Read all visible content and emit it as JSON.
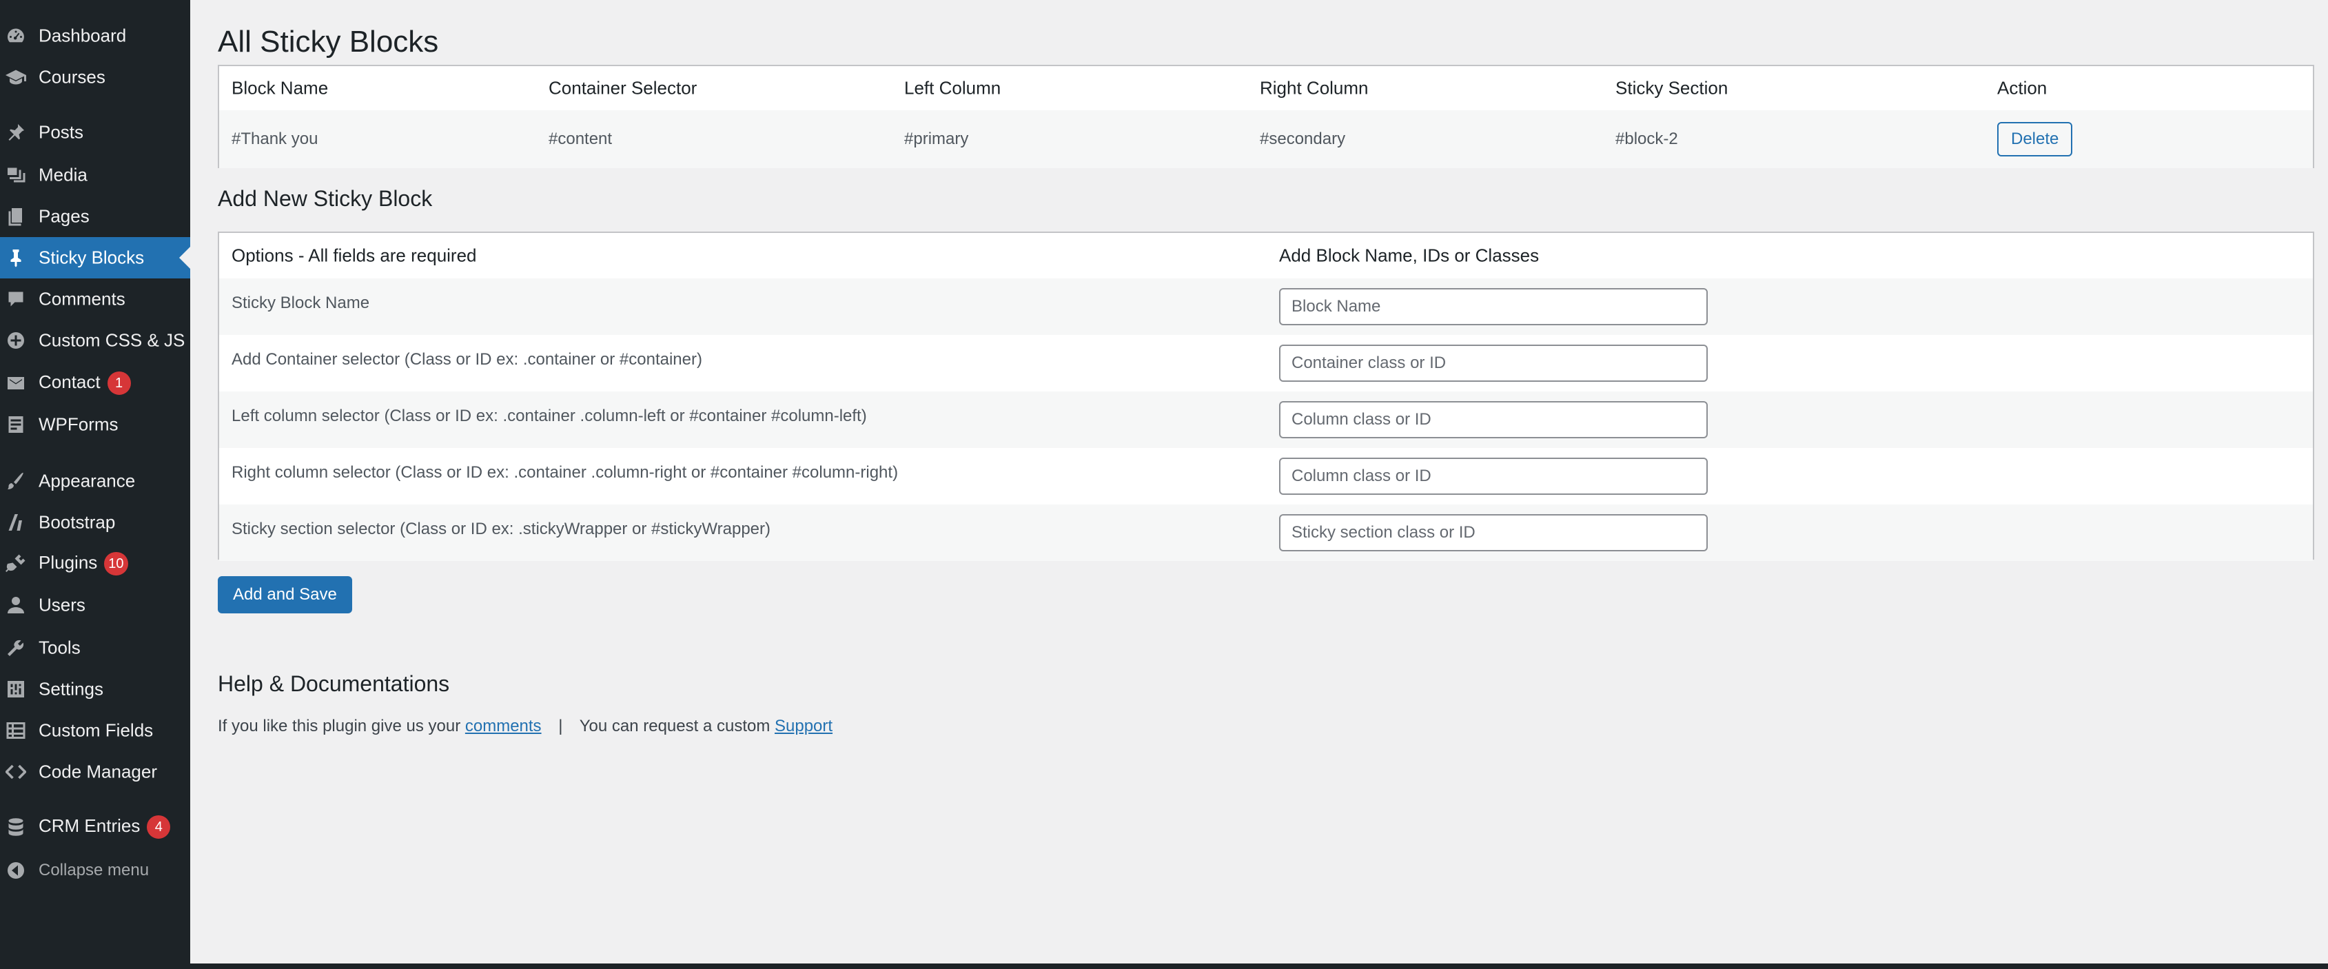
{
  "sidebar": {
    "items": [
      {
        "label": "Dashboard",
        "icon": "dashboard-icon"
      },
      {
        "label": "Courses",
        "icon": "graduation-cap-icon"
      },
      {
        "label": "Posts",
        "icon": "pin-icon"
      },
      {
        "label": "Media",
        "icon": "media-icon"
      },
      {
        "label": "Pages",
        "icon": "pages-icon"
      },
      {
        "label": "Sticky Blocks",
        "icon": "pin-icon",
        "active": true
      },
      {
        "label": "Comments",
        "icon": "comment-icon"
      },
      {
        "label": "Custom CSS & JS",
        "icon": "plus-circle-icon"
      },
      {
        "label": "Contact",
        "icon": "mail-icon",
        "badge": "1"
      },
      {
        "label": "WPForms",
        "icon": "form-icon"
      },
      {
        "label": "Appearance",
        "icon": "paintbrush-icon"
      },
      {
        "label": "Bootstrap",
        "icon": "bootstrap-icon"
      },
      {
        "label": "Plugins",
        "icon": "plug-icon",
        "badge": "10"
      },
      {
        "label": "Users",
        "icon": "user-icon"
      },
      {
        "label": "Tools",
        "icon": "wrench-icon"
      },
      {
        "label": "Settings",
        "icon": "settings-icon"
      },
      {
        "label": "Custom Fields",
        "icon": "grid-icon"
      },
      {
        "label": "Code Manager",
        "icon": "code-icon"
      },
      {
        "label": "CRM Entries",
        "icon": "database-icon",
        "badge": "4"
      },
      {
        "label": "Collapse menu",
        "icon": "collapse-icon"
      }
    ]
  },
  "main": {
    "title": "All Sticky Blocks",
    "table": {
      "headers": [
        "Block Name",
        "Container Selector",
        "Left Column",
        "Right Column",
        "Sticky Section",
        "Action"
      ],
      "rows": [
        {
          "block_name": "#Thank you",
          "container": "#content",
          "left": "#primary",
          "right": "#secondary",
          "sticky": "#block-2",
          "action": "Delete"
        }
      ]
    },
    "add_heading": "Add New Sticky Block",
    "options": {
      "header_left": "Options - All fields are required",
      "header_right": "Add Block Name, IDs or Classes",
      "fields": [
        {
          "label": "Sticky Block Name",
          "placeholder": "Block Name",
          "value": ""
        },
        {
          "label": "Add Container selector (Class or ID ex: .container or #container)",
          "placeholder": "Container class or ID",
          "value": ""
        },
        {
          "label": "Left column selector (Class or ID ex: .container .column-left or #container #column-left)",
          "placeholder": "Column class or ID",
          "value": ""
        },
        {
          "label": "Right column selector (Class or ID ex: .container .column-right or #container #column-right)",
          "placeholder": "Column class or ID",
          "value": ""
        },
        {
          "label": "Sticky section selector (Class or ID ex: .stickyWrapper or #stickyWrapper)",
          "placeholder": "Sticky section class or ID",
          "value": ""
        }
      ]
    },
    "save_label": "Add and Save",
    "help": {
      "heading": "Help & Documentations",
      "text1": "If you like this plugin give us your",
      "link1": "comments",
      "separator": "|",
      "text2": "You can request a custom",
      "link2": "Support"
    }
  },
  "colors": {
    "sidebar_bg": "#1d2327",
    "accent": "#2271b1",
    "badge": "#d63638",
    "content_bg": "#f0f0f1"
  }
}
